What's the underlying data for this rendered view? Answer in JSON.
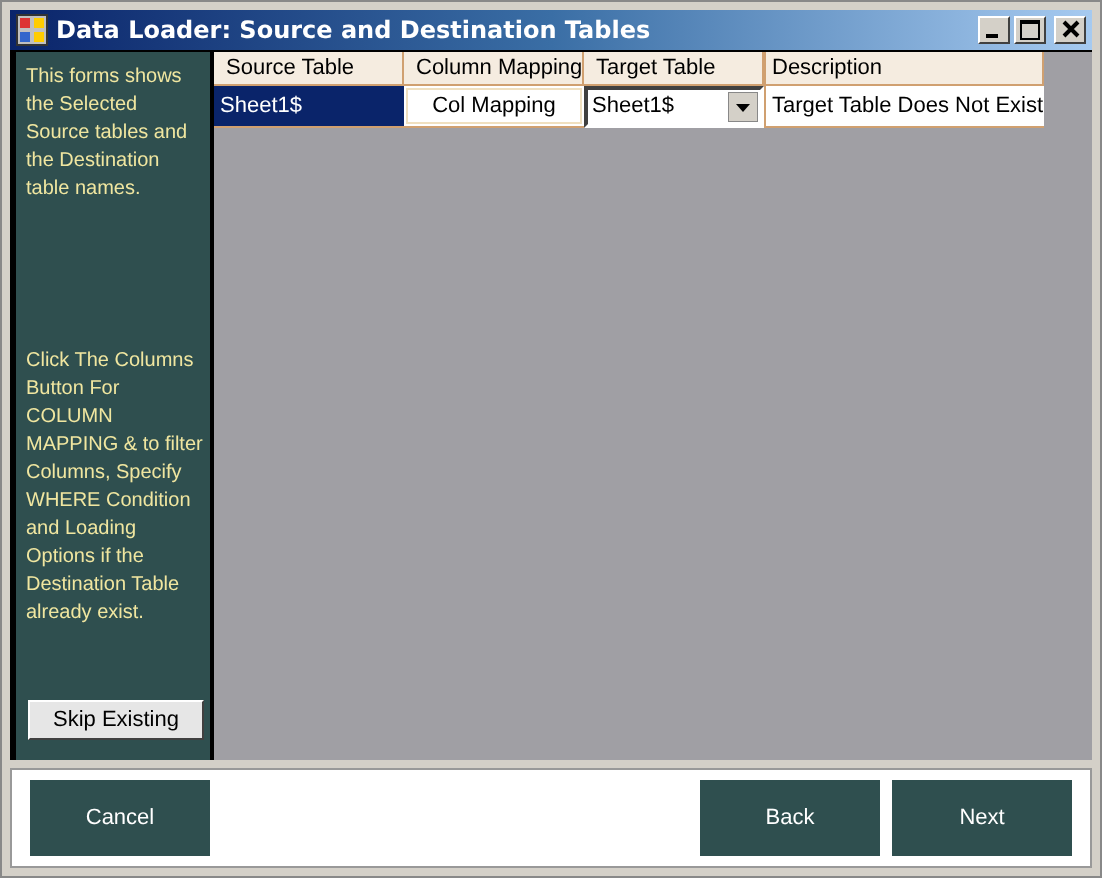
{
  "window": {
    "title": "Data Loader: Source and Destination Tables"
  },
  "sidebar": {
    "intro": "This forms shows the Selected Source tables and the Destination table names.",
    "help": "Click The Columns Button For COLUMN MAPPING & to filter Columns, Specify WHERE Condition and Loading Options if the Destination Table already exist.",
    "button": "Skip Existing"
  },
  "table": {
    "columns": [
      "Source Table",
      "Column Mapping",
      "Target Table",
      "Description"
    ],
    "rows": [
      {
        "selected": true,
        "source": "Sheet1$",
        "mapping_button": "Col Mapping",
        "target": "Sheet1$",
        "description": "Target Table Does Not Exist"
      }
    ]
  },
  "footer": {
    "left_buttons": [
      "Cancel"
    ],
    "right_buttons": [
      "Back",
      "Next"
    ]
  }
}
